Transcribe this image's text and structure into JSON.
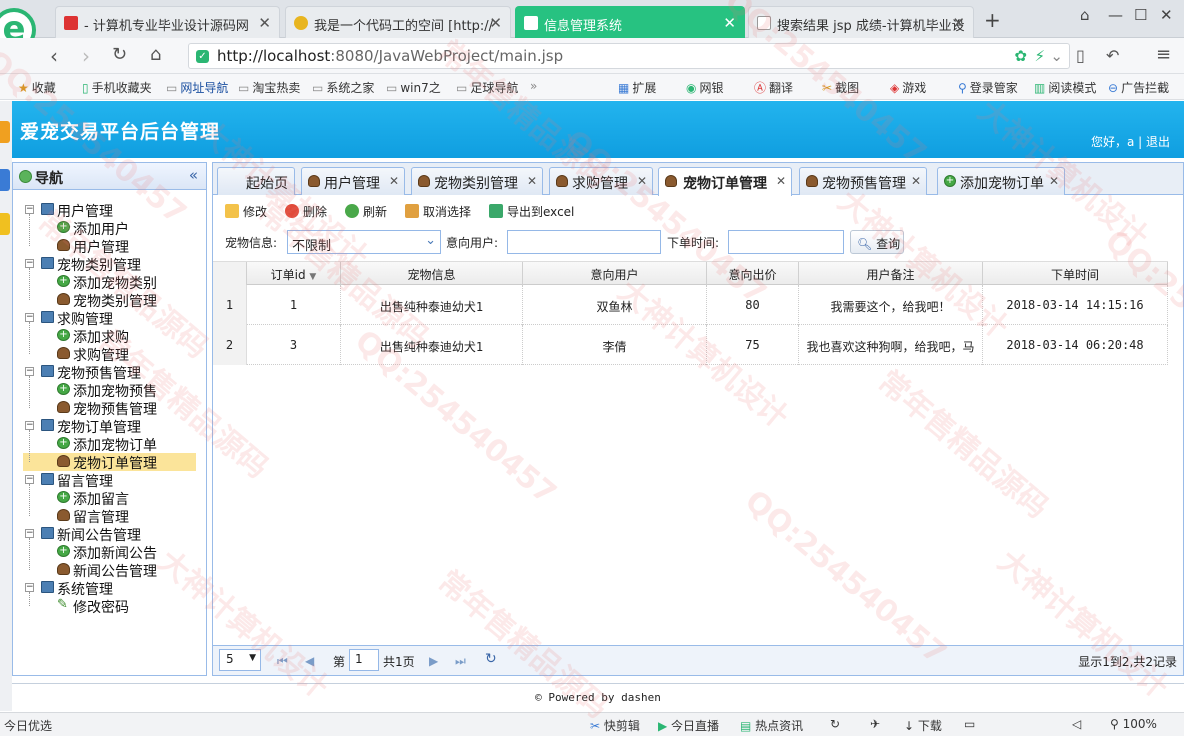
{
  "browser": {
    "tabs": [
      {
        "label": "- 计算机专业毕业设计源码网",
        "active": false
      },
      {
        "label": "我是一个代码工的空间 [http://",
        "active": false
      },
      {
        "label": "信息管理系统",
        "active": true
      },
      {
        "label": "搜索结果 jsp 成绩-计算机毕业设",
        "active": false
      }
    ],
    "new_tab": "+",
    "url_host": "http://localhost",
    "url_path": ":8080/JavaWebProject/main.jsp",
    "bookmarks": [
      "收藏",
      "手机收藏夹",
      "网址导航",
      "淘宝热卖",
      "系统之家",
      "win7之",
      "足球导航"
    ],
    "bookmark_more": "»",
    "tools": [
      "扩展",
      "网银",
      "翻译",
      "截图",
      "游戏",
      "登录管家",
      "阅读模式",
      "广告拦截"
    ]
  },
  "app": {
    "title": "爱宠交易平台后台管理",
    "greeting": "您好，a | 退出"
  },
  "nav": {
    "title": "导航",
    "collapse": "«",
    "groups": [
      {
        "label": "用户管理",
        "items": [
          "添加用户",
          "用户管理"
        ]
      },
      {
        "label": "宠物类别管理",
        "items": [
          "添加宠物类别",
          "宠物类别管理"
        ]
      },
      {
        "label": "求购管理",
        "items": [
          "添加求购",
          "求购管理"
        ]
      },
      {
        "label": "宠物预售管理",
        "items": [
          "添加宠物预售",
          "宠物预售管理"
        ]
      },
      {
        "label": "宠物订单管理",
        "items": [
          "添加宠物订单",
          "宠物订单管理"
        ]
      },
      {
        "label": "留言管理",
        "items": [
          "添加留言",
          "留言管理"
        ]
      },
      {
        "label": "新闻公告管理",
        "items": [
          "添加新闻公告",
          "新闻公告管理"
        ]
      },
      {
        "label": "系统管理",
        "items": [
          "修改密码"
        ]
      }
    ],
    "selected": "宠物订单管理"
  },
  "main_tabs": [
    "起始页",
    "用户管理",
    "宠物类别管理",
    "求购管理",
    "宠物订单管理",
    "宠物预售管理",
    "添加宠物订单"
  ],
  "toolbar": {
    "edit": "修改",
    "delete": "删除",
    "refresh": "刷新",
    "unselect": "取消选择",
    "export": "导出到excel"
  },
  "filters": {
    "pet_label": "宠物信息:",
    "pet_value": "不限制",
    "user_label": "意向用户:",
    "user_value": "",
    "time_label": "下单时间:",
    "time_value": "",
    "query": "查询"
  },
  "grid": {
    "columns": [
      "订单id",
      "宠物信息",
      "意向用户",
      "意向出价",
      "用户备注",
      "下单时间"
    ],
    "rows": [
      {
        "rownum": "1",
        "id": "1",
        "pet": "出售纯种泰迪幼犬1",
        "user": "双鱼林",
        "price": "80",
        "note": "我需要这个，给我吧！",
        "time": "2018-03-14 14:15:16"
      },
      {
        "rownum": "2",
        "id": "3",
        "pet": "出售纯种泰迪幼犬1",
        "user": "李倩",
        "price": "75",
        "note": "我也喜欢这种狗啊，给我吧，马",
        "time": "2018-03-14 06:20:48"
      }
    ]
  },
  "pager": {
    "page_size": "5",
    "page_prefix": "第",
    "page": "1",
    "page_total": "共1页",
    "summary": "显示1到2,共2记录"
  },
  "footer": "© Powered by dashen",
  "statusbar": {
    "left": "今日优选",
    "items": [
      "快剪辑",
      "今日直播",
      "热点资讯",
      "下载",
      "100%"
    ]
  },
  "watermarks": [
    "QQ:254540457",
    "大神计算机设计",
    "常年售精品源码"
  ],
  "colors": {
    "header": "#1aa8e8",
    "active_tab": "#27c281",
    "selected_node": "#fbe49a"
  }
}
